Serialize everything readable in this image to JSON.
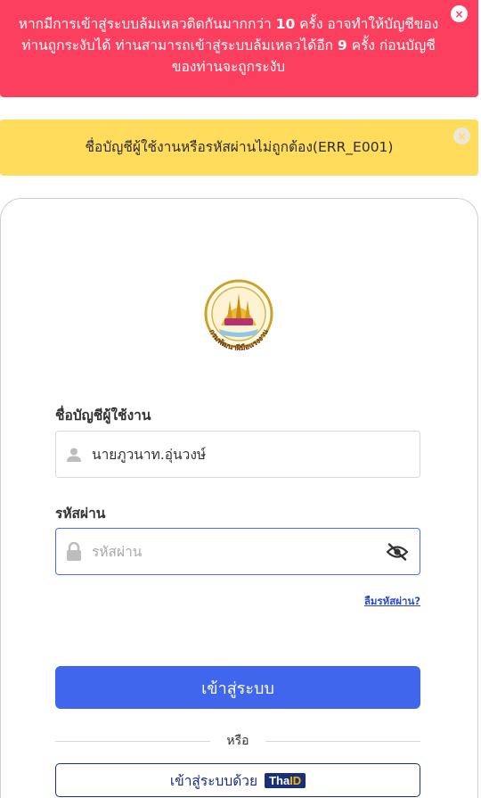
{
  "alerts": {
    "lockout": {
      "part1": "หากมีการเข้าสู่ระบบล้มเหลวติดกันมากกว่า ",
      "max_attempts": "10",
      "part2": " ครั้ง อาจทำให้บัญชีของท่านถูกระงับได้ ท่านสามารถเข้าสู่ระบบล้มเหลวได้อีก ",
      "remaining": "9",
      "part3": " ครั้ง ก่อนบัญชีของท่านจะถูกระงับ",
      "close": "×"
    },
    "error": {
      "message": "ชื่อบัญชีผู้ใช้งานหรือรหัสผ่านไม่ถูกต้อง(ERR_E001)",
      "close": "×"
    }
  },
  "logo": {
    "text": "กรมพัฒนาฝีมือแรงงาน",
    "icon": "department-seal"
  },
  "form": {
    "username_label": "ชื่อบัญชีผู้ใช้งาน",
    "username_value": "นายภูวนาท.อุ่นวงษ์",
    "username_icon": "user-icon",
    "password_label": "รหัสผ่าน",
    "password_placeholder": "รหัสผ่าน",
    "password_icon": "lock-icon",
    "toggle_icon": "eye-off-icon",
    "forgot_link": "ลืมรหัสผ่าน?",
    "login_button": "เข้าสู่ระบบ",
    "divider_text": "หรือ",
    "thaid_button": "เข้าสู่ระบบด้วย",
    "thaid_logo_tha": "Tha",
    "thaid_logo_id": "ID"
  },
  "colors": {
    "danger": "#fc3f5e",
    "warning": "#ffdc5c",
    "primary": "#4066ee",
    "thaid": "#1a2f7c"
  }
}
